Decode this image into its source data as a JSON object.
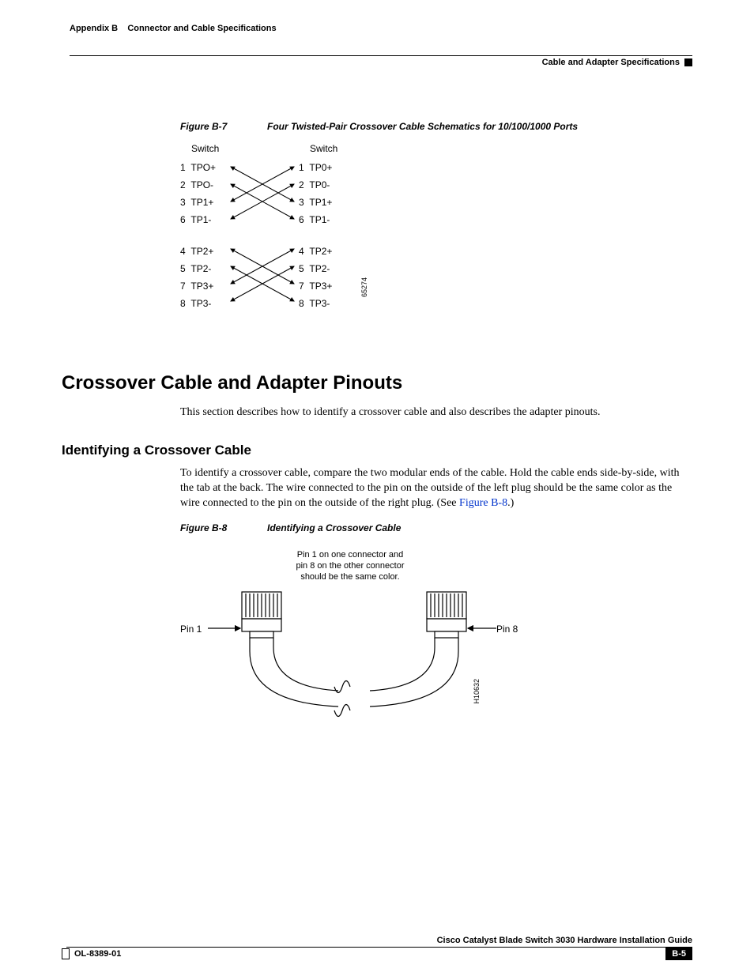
{
  "header": {
    "appendix": "Appendix B",
    "chapter_title": "Connector and Cable Specifications",
    "section_title": "Cable and Adapter Specifications"
  },
  "figure_b7": {
    "label": "Figure B-7",
    "title": "Four Twisted-Pair Crossover Cable Schematics for 10/100/1000 Ports",
    "left_header": "Switch",
    "right_header": "Switch",
    "id": "65274",
    "left_pins": [
      {
        "n": "1",
        "s": "TPO+"
      },
      {
        "n": "2",
        "s": "TPO-"
      },
      {
        "n": "3",
        "s": "TP1+"
      },
      {
        "n": "6",
        "s": "TP1-"
      },
      {
        "n": "4",
        "s": "TP2+"
      },
      {
        "n": "5",
        "s": "TP2-"
      },
      {
        "n": "7",
        "s": "TP3+"
      },
      {
        "n": "8",
        "s": "TP3-"
      }
    ],
    "right_pins": [
      {
        "n": "1",
        "s": "TP0+"
      },
      {
        "n": "2",
        "s": "TP0-"
      },
      {
        "n": "3",
        "s": "TP1+"
      },
      {
        "n": "6",
        "s": "TP1-"
      },
      {
        "n": "4",
        "s": "TP2+"
      },
      {
        "n": "5",
        "s": "TP2-"
      },
      {
        "n": "7",
        "s": "TP3+"
      },
      {
        "n": "8",
        "s": "TP3-"
      }
    ]
  },
  "sections": {
    "h1": "Crossover Cable and Adapter Pinouts",
    "intro": "This section describes how to identify a crossover cable and also describes the adapter pinouts.",
    "h2": "Identifying a Crossover Cable",
    "para2_a": "To identify a crossover cable, compare the two modular ends of the cable. Hold the cable ends side-by-side, with the tab at the back. The wire connected to the pin on the outside of the left plug should be the same color as the wire connected to the pin on the outside of the right plug. (See ",
    "para2_link": "Figure B-8",
    "para2_b": ".)"
  },
  "figure_b8": {
    "label": "Figure B-8",
    "title": "Identifying a Crossover Cable",
    "caption_line1": "Pin 1 on one connector and",
    "caption_line2": "pin 8 on the other connector",
    "caption_line3": "should be the same color.",
    "pin1": "Pin 1",
    "pin8": "Pin 8",
    "id": "H10632"
  },
  "footer": {
    "guide": "Cisco Catalyst Blade Switch 3030 Hardware Installation Guide",
    "doc_id": "OL-8389-01",
    "page": "B-5"
  }
}
